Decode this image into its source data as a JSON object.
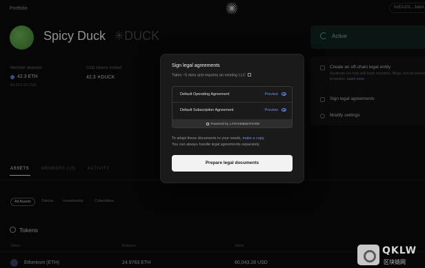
{
  "topbar": {
    "section": "Portfolio",
    "wallet": "0xEA101...3e6A"
  },
  "dao": {
    "name": "Spicy Duck",
    "ticker": "✳DUCK"
  },
  "stats": {
    "member_deposits": {
      "label": "Member deposits",
      "value": "42.3 ETH",
      "sub": "84,553.18 USD"
    },
    "club_tokens": {
      "label": "Club tokens minted",
      "value": "42.3 ✳DUCK"
    }
  },
  "status": {
    "label": "Active",
    "color": "#6ac4ad"
  },
  "actions": [
    {
      "label": "Create an off-chain legal entity",
      "desc": "Syndicate can help with basic formation, filings, and document templates.",
      "link": "Learn more"
    },
    {
      "label": "Sign legal agreements"
    },
    {
      "label": "Modify settings"
    }
  ],
  "tabs": [
    "ASSETS",
    "MEMBERS (15)",
    "ACTIVITY"
  ],
  "filters": [
    "All Assets",
    "Tokens",
    "Investments",
    "Collectibles"
  ],
  "tokens": {
    "title": "Tokens",
    "columns": [
      "Token",
      "Balance",
      "Value"
    ],
    "rows": [
      {
        "token": "Ethereum (ETH)",
        "balance": "24.9763 ETH",
        "value": "60,043.28 USD"
      }
    ]
  },
  "modal": {
    "title": "Sign legal agreements",
    "subtitle": "Takes ~5 mins and requires an existing LLC",
    "documents": [
      {
        "name": "Default Operating Agreement",
        "action": "Preview"
      },
      {
        "name": "Default Subscription Agreement",
        "action": "Preview"
      }
    ],
    "powered_by": "Powered by LATHAM&WATKINS",
    "note_line1_prefix": "To adapt these documents to your needs, ",
    "note_line1_link": "make a copy.",
    "note_line2": "You can always handle legal agreements separately.",
    "primary_button": "Prepare legal documents"
  },
  "watermark": {
    "main": "QKLW",
    "sub": "区块链网"
  },
  "colors": {
    "accent": "#6f90e6",
    "background": "#0b0b0b",
    "modal": "#1a1a1a"
  }
}
